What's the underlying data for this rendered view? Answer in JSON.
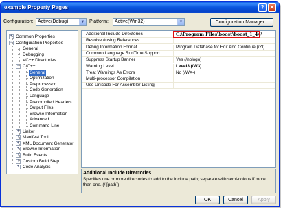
{
  "window": {
    "title": "example Property Pages",
    "help_glyph": "?",
    "close_glyph": "✕"
  },
  "toolbar": {
    "configuration_label": "Configuration:",
    "configuration_value": "Active(Debug)",
    "platform_label": "Platform:",
    "platform_value": "Active(Win32)",
    "config_manager_label": "Configuration Manager...",
    "dropdown_glyph": "▼"
  },
  "tree": [
    {
      "label": "Common Properties",
      "expander": "+"
    },
    {
      "label": "Configuration Properties",
      "expander": "−"
    },
    {
      "label": "General"
    },
    {
      "label": "Debugging"
    },
    {
      "label": "VC++ Directories"
    },
    {
      "label": "C/C++",
      "expander": "−"
    },
    {
      "label": "General",
      "selected": true
    },
    {
      "label": "Optimization"
    },
    {
      "label": "Preprocessor"
    },
    {
      "label": "Code Generation"
    },
    {
      "label": "Language"
    },
    {
      "label": "Precompiled Headers"
    },
    {
      "label": "Output Files"
    },
    {
      "label": "Browse Information"
    },
    {
      "label": "Advanced"
    },
    {
      "label": "Command Line"
    },
    {
      "label": "Linker",
      "expander": "+"
    },
    {
      "label": "Manifest Tool",
      "expander": "+"
    },
    {
      "label": "XML Document Generator",
      "expander": "+"
    },
    {
      "label": "Browse Information",
      "expander": "+"
    },
    {
      "label": "Build Events",
      "expander": "+"
    },
    {
      "label": "Custom Build Step",
      "expander": "+"
    },
    {
      "label": "Code Analysis",
      "expander": "+"
    }
  ],
  "properties": [
    {
      "name": "Additional Include Directories",
      "value": "C:\\Program Files\\boost\\boost_1_44\\"
    },
    {
      "name": "Resolve #using References",
      "value": ""
    },
    {
      "name": "Debug Information Format",
      "value": "Program Database for Edit And Continue (/ZI)"
    },
    {
      "name": "Common Language RunTime Support",
      "value": ""
    },
    {
      "name": "Suppress Startup Banner",
      "value": "Yes (/nologo)"
    },
    {
      "name": "Warning Level",
      "value": "Level3 (/W3)"
    },
    {
      "name": "Treat Warnings As Errors",
      "value": "No (/WX-)"
    },
    {
      "name": "Multi-processor Compilation",
      "value": ""
    },
    {
      "name": "Use Unicode For Assembler Listing",
      "value": ""
    }
  ],
  "description": {
    "title": "Additional Include Directories",
    "body": "Specifies one or more directories to add to the include path; separate with semi-colons if more than one. (/I[path])"
  },
  "buttons": {
    "ok": "OK",
    "cancel": "Cancel",
    "apply": "Apply"
  }
}
